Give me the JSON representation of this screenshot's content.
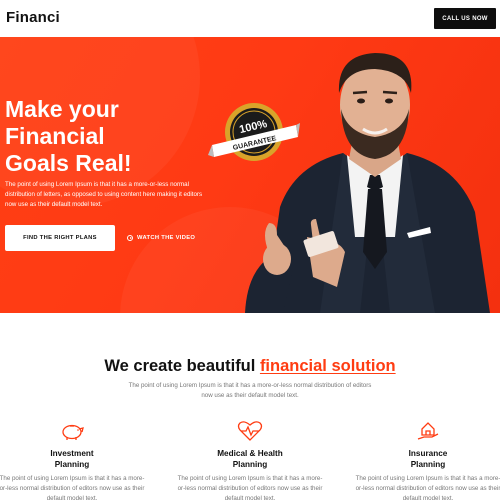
{
  "header": {
    "logo": "Financi",
    "cta_label": "CALL US NOW"
  },
  "hero": {
    "headline_line1": "Make your",
    "headline_line2": "Financial",
    "headline_line3": "Goals Real!",
    "description": "The point of using Lorem Ipsum is that it has a more-or-less normal distribution of letters, as opposed to using content here making it editors now use as their default model text.",
    "primary_button": "FIND THE RIGHT PLANS",
    "video_link": "WATCH THE VIDEO",
    "badge_number": "100%",
    "badge_text": "GUARANTEE"
  },
  "section": {
    "title_plain": "We create beautiful ",
    "title_accent": "financial solution",
    "description": "The point of using Lorem Ipsum is that it has a more-or-less normal distribution of editors now use as their default model text."
  },
  "services": [
    {
      "icon": "piggy-bank-icon",
      "title_line1": "Investment",
      "title_line2": "Planning",
      "description": "The point of using Lorem Ipsum is that it has a more-or-less normal distribution of editors now use as their default model text."
    },
    {
      "icon": "heart-pulse-icon",
      "title_line1": "Medical & Health",
      "title_line2": "Planning",
      "description": "The point of using Lorem Ipsum is that it has a more-or-less normal distribution of editors now use as their default model text."
    },
    {
      "icon": "house-hand-icon",
      "title_line1": "Insurance",
      "title_line2": "Planning",
      "description": "The point of using Lorem Ipsum is that it has a more-or-less normal distribution of editors now use as their default model text."
    }
  ],
  "colors": {
    "accent": "#ff3c12",
    "dark": "#0e0e0e"
  }
}
